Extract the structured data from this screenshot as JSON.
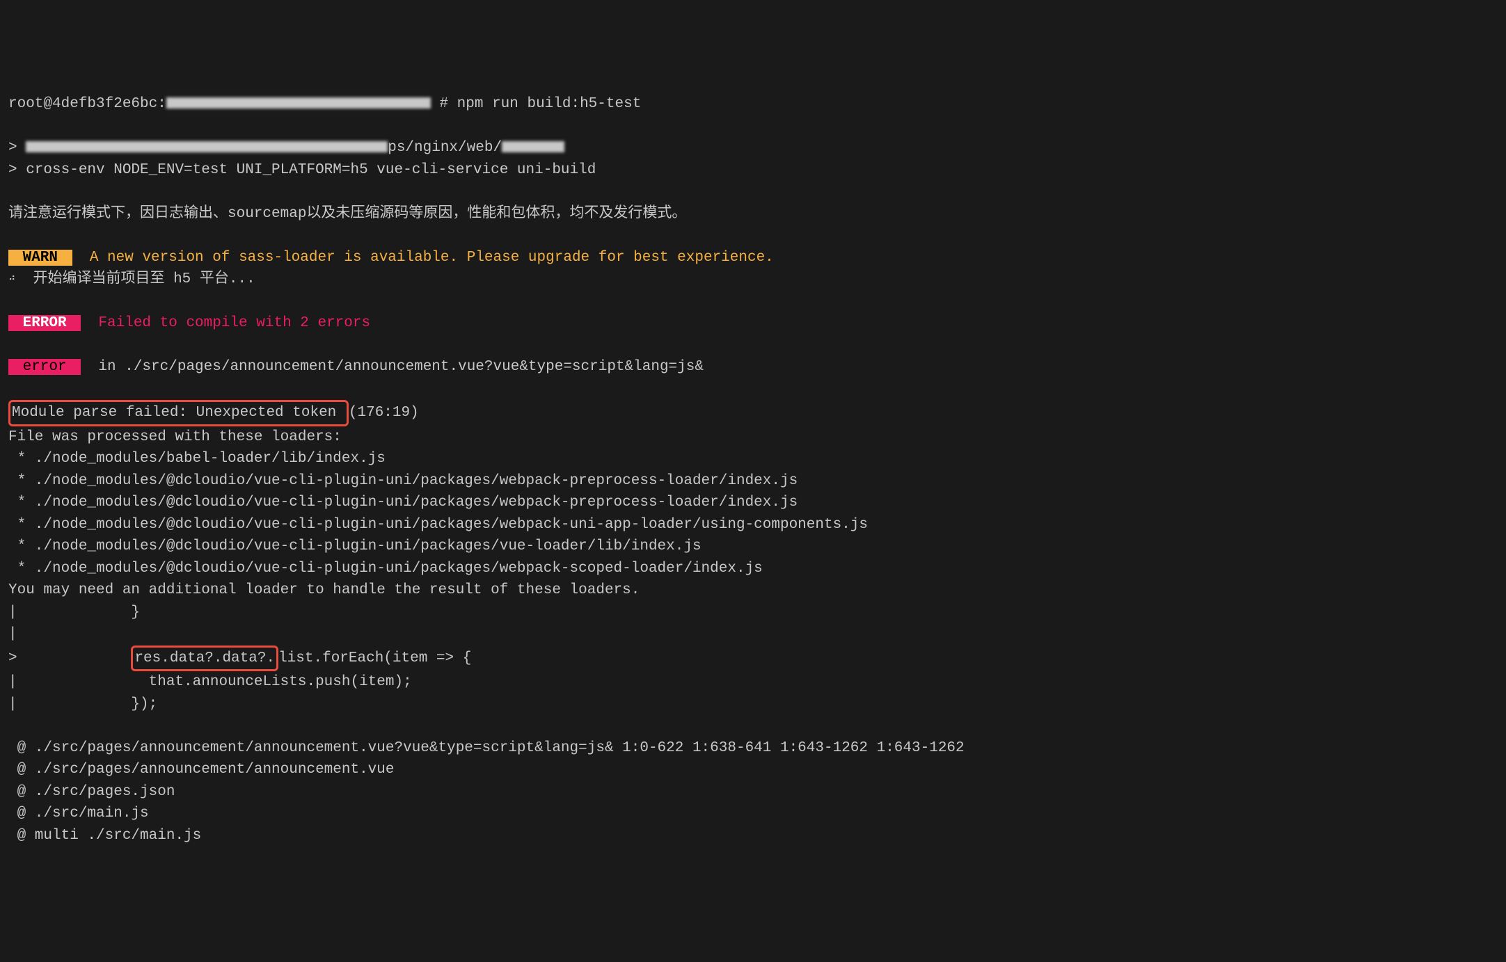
{
  "line0_partial": "  ---- ---- ----- --- -- --- ----: -- -- -- ----- --- -------",
  "prompt_user": "root@4defb3f2e6bc:",
  "prompt_path_obscured": "▇ ▇ ▇▇ ▇:▇▇▇▇ ▇:▇▇.▇▇▇",
  "prompt_suffix": " # ",
  "command": "npm run build:h5-test",
  "empty": "",
  "script_line1_prefix": "> ",
  "script_line1_obscured": "▇▇▇▇▇▇ ▇▇▇ ▇▇ ▇▇ ▇▇▇▇:▇ ▇▇▇▇▇▇▇",
  "script_line1_mid": "ps/nginx/web/",
  "script_line1_obscured2": "▇ ▇▇▇",
  "script_line2": "> cross-env NODE_ENV=test UNI_PLATFORM=h5 vue-cli-service uni-build",
  "notice_cn": "请注意运行模式下，因日志输出、sourcemap以及未压缩源码等原因，性能和包体积，均不及发行模式。",
  "warn_label": " WARN ",
  "warn_msg": "  A new version of sass-loader is available. Please upgrade for best experience.",
  "compile_icon_label": "⠴",
  "compile_msg": "  开始编译当前项目至 h5 平台...",
  "error_label": " ERROR ",
  "error_msg": "  Failed to compile with 2 errors",
  "error_label2": " error ",
  "error_in": "  in ./src/pages/announcement/announcement.vue?vue&type=script&lang=js&",
  "module_parse_hl": "Module parse failed: Unexpected token ",
  "module_parse_loc": "(176:19)",
  "file_processed": "File was processed with these loaders:",
  "loader1": " * ./node_modules/babel-loader/lib/index.js",
  "loader2": " * ./node_modules/@dcloudio/vue-cli-plugin-uni/packages/webpack-preprocess-loader/index.js",
  "loader3": " * ./node_modules/@dcloudio/vue-cli-plugin-uni/packages/webpack-preprocess-loader/index.js",
  "loader4": " * ./node_modules/@dcloudio/vue-cli-plugin-uni/packages/webpack-uni-app-loader/using-components.js",
  "loader5": " * ./node_modules/@dcloudio/vue-cli-plugin-uni/packages/vue-loader/lib/index.js",
  "loader6": " * ./node_modules/@dcloudio/vue-cli-plugin-uni/packages/webpack-scoped-loader/index.js",
  "need_loader": "You may need an additional loader to handle the result of these loaders.",
  "code1": "|             }",
  "code2": "|",
  "code3_prefix": ">             ",
  "code3_hl": "res.data?.data?.",
  "code3_suffix": "list.forEach(item => {",
  "code4": "|               that.announceLists.push(item);",
  "code5": "|             });",
  "at1": " @ ./src/pages/announcement/announcement.vue?vue&type=script&lang=js& 1:0-622 1:638-641 1:643-1262 1:643-1262",
  "at2": " @ ./src/pages/announcement/announcement.vue",
  "at3": " @ ./src/pages.json",
  "at4": " @ ./src/main.js",
  "at5": " @ multi ./src/main.js"
}
